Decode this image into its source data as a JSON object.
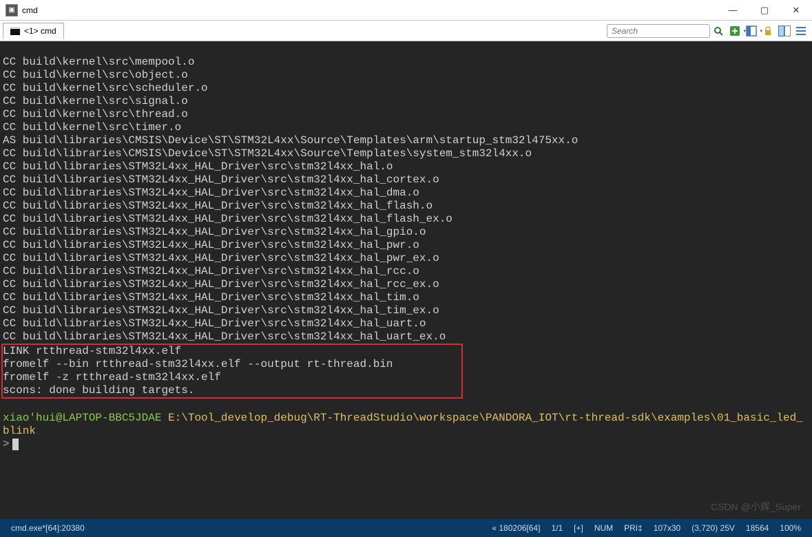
{
  "title": "cmd",
  "tab": {
    "label": "<1> cmd"
  },
  "search": {
    "placeholder": "Search"
  },
  "terminal": {
    "lines": [
      "CC build\\kernel\\src\\mempool.o",
      "CC build\\kernel\\src\\object.o",
      "CC build\\kernel\\src\\scheduler.o",
      "CC build\\kernel\\src\\signal.o",
      "CC build\\kernel\\src\\thread.o",
      "CC build\\kernel\\src\\timer.o",
      "AS build\\libraries\\CMSIS\\Device\\ST\\STM32L4xx\\Source\\Templates\\arm\\startup_stm32l475xx.o",
      "CC build\\libraries\\CMSIS\\Device\\ST\\STM32L4xx\\Source\\Templates\\system_stm32l4xx.o",
      "CC build\\libraries\\STM32L4xx_HAL_Driver\\src\\stm32l4xx_hal.o",
      "CC build\\libraries\\STM32L4xx_HAL_Driver\\src\\stm32l4xx_hal_cortex.o",
      "CC build\\libraries\\STM32L4xx_HAL_Driver\\src\\stm32l4xx_hal_dma.o",
      "CC build\\libraries\\STM32L4xx_HAL_Driver\\src\\stm32l4xx_hal_flash.o",
      "CC build\\libraries\\STM32L4xx_HAL_Driver\\src\\stm32l4xx_hal_flash_ex.o",
      "CC build\\libraries\\STM32L4xx_HAL_Driver\\src\\stm32l4xx_hal_gpio.o",
      "CC build\\libraries\\STM32L4xx_HAL_Driver\\src\\stm32l4xx_hal_pwr.o",
      "CC build\\libraries\\STM32L4xx_HAL_Driver\\src\\stm32l4xx_hal_pwr_ex.o",
      "CC build\\libraries\\STM32L4xx_HAL_Driver\\src\\stm32l4xx_hal_rcc.o",
      "CC build\\libraries\\STM32L4xx_HAL_Driver\\src\\stm32l4xx_hal_rcc_ex.o",
      "CC build\\libraries\\STM32L4xx_HAL_Driver\\src\\stm32l4xx_hal_tim.o",
      "CC build\\libraries\\STM32L4xx_HAL_Driver\\src\\stm32l4xx_hal_tim_ex.o",
      "CC build\\libraries\\STM32L4xx_HAL_Driver\\src\\stm32l4xx_hal_uart.o",
      "CC build\\libraries\\STM32L4xx_HAL_Driver\\src\\stm32l4xx_hal_uart_ex.o"
    ],
    "box": [
      "LINK rtthread-stm32l4xx.elf",
      "fromelf --bin rtthread-stm32l4xx.elf --output rt-thread.bin",
      "fromelf -z rtthread-stm32l4xx.elf",
      "scons: done building targets."
    ],
    "prompt_user": "xiao'hui@LAPTOP-BBC5JDAE",
    "prompt_path": "E:\\Tool_develop_debug\\RT-ThreadStudio\\workspace\\PANDORA_IOT\\rt-thread-sdk\\examples\\01_basic_led_blink",
    "prompt_symbol": ">"
  },
  "watermark": "CSDN @小辉_Super",
  "status": {
    "left": "cmd.exe*[64]:20380",
    "enc": "« 180206[64]",
    "pos": "1/1",
    "ins": "[+]",
    "num": "NUM",
    "pri": "PRI‡",
    "size": "107x30",
    "cursor": "(3,720) 25V",
    "chars": "18564",
    "zoom": "100%"
  }
}
